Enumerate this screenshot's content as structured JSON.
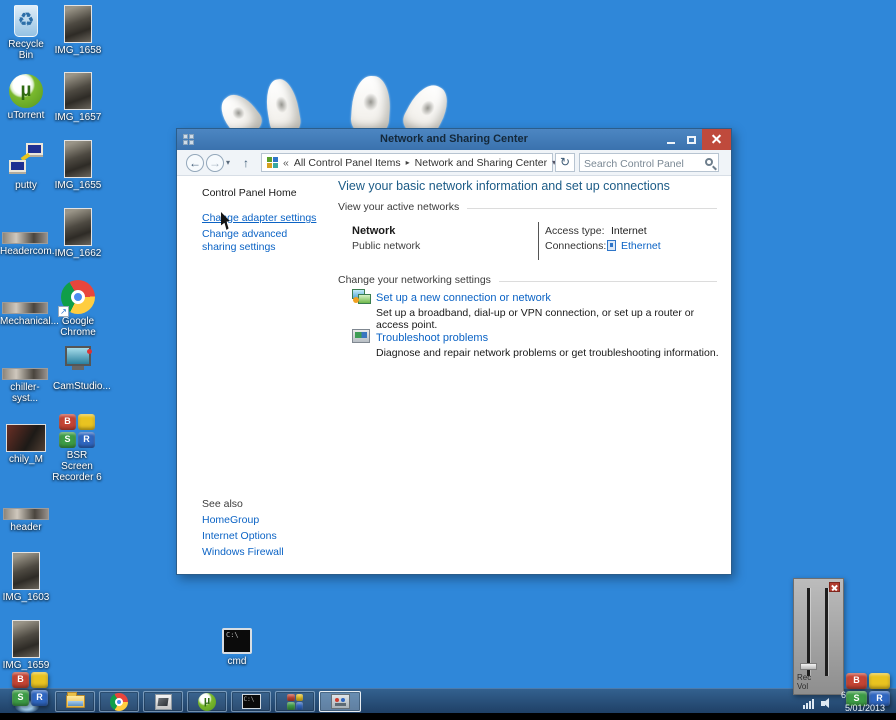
{
  "colors": {
    "desktop": "#2f87d9",
    "titlebar": "#3f7cc0",
    "link": "#0b63c5",
    "heading": "#1d5c87",
    "taskbar": "#234a70",
    "close_red": "#bf4a3c"
  },
  "glyphs": {
    "recycle": "♻",
    "mu": "µ",
    "back": "←",
    "forward": "→",
    "up": "↑",
    "refresh": "↻",
    "dropdown": "▾",
    "shortcut": "↗",
    "cmd": "C:\\",
    "bsr_tl": "B",
    "bsr_tr": "",
    "bsr_bl": "S",
    "bsr_br": "R"
  },
  "desktop": {
    "icons": [
      {
        "label": "Recycle Bin"
      },
      {
        "label": "IMG_1658"
      },
      {
        "label": "uTorrent"
      },
      {
        "label": "IMG_1657"
      },
      {
        "label": "putty"
      },
      {
        "label": "IMG_1655"
      },
      {
        "label": "Headercom..."
      },
      {
        "label": "IMG_1662"
      },
      {
        "label": "Mechanical..."
      },
      {
        "label": "Google Chrome"
      },
      {
        "label": "chiller-syst..."
      },
      {
        "label": "CamStudio..."
      },
      {
        "label": "chily_M"
      },
      {
        "label": "BSR Screen Recorder 6"
      },
      {
        "label": "header"
      },
      {
        "label": "IMG_1603"
      },
      {
        "label": "IMG_1659"
      },
      {
        "label": "cmd"
      }
    ]
  },
  "window": {
    "title": "Network and Sharing Center",
    "toolbar": {
      "breadcrumb_prefix": "«",
      "crumb1": "All Control Panel Items",
      "crumb_separator": "▸",
      "crumb2": "Network and Sharing Center",
      "search_placeholder": "Search Control Panel"
    },
    "sidebar": {
      "home": "Control Panel Home",
      "adapter_link": "Change adapter settings",
      "sharing_link": "Change advanced sharing settings",
      "see_also": "See also",
      "homegroup": "HomeGroup",
      "internet_options": "Internet Options",
      "windows_firewall": "Windows Firewall"
    },
    "main": {
      "heading": "View your basic network information and set up connections",
      "active_networks_label": "View your active networks",
      "network_name": "Network",
      "network_type": "Public network",
      "access_type_label": "Access type:",
      "access_type_value": "Internet",
      "connections_label": "Connections:",
      "connections_value": "Ethernet",
      "change_settings_label": "Change your networking settings",
      "setup_title": "Set up a new connection or network",
      "setup_desc": "Set up a broadband, dial-up or VPN connection, or set up a router or access point.",
      "troubleshoot_title": "Troubleshoot problems",
      "troubleshoot_desc": "Diagnose and repair network problems or get troubleshooting information."
    }
  },
  "tray": {
    "time": "6:",
    "date": "5/01/2013"
  },
  "volume_panel": {
    "rec_label": "Rec",
    "vol_label": "Vol"
  }
}
